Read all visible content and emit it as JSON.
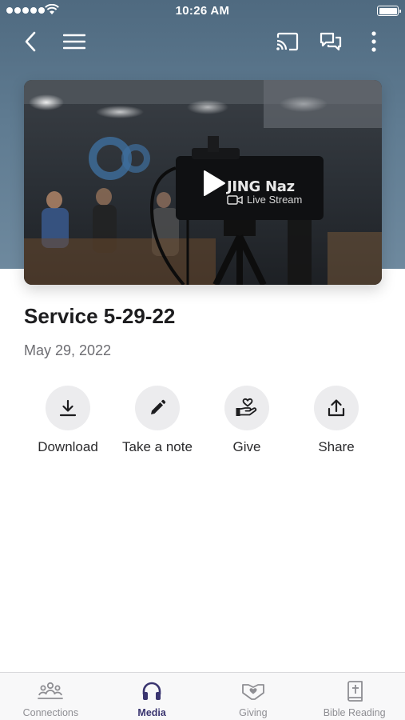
{
  "status_bar": {
    "time": "10:26 AM"
  },
  "video": {
    "overlay_brand": "JING Naz",
    "overlay_subtitle": "Live Stream"
  },
  "sermon": {
    "title": "Service 5-29-22",
    "date": "May 29, 2022"
  },
  "actions": [
    {
      "label": "Download",
      "icon": "download-icon"
    },
    {
      "label": "Take a note",
      "icon": "pencil-icon"
    },
    {
      "label": "Give",
      "icon": "give-icon"
    },
    {
      "label": "Share",
      "icon": "share-icon"
    }
  ],
  "tabs": [
    {
      "label": "Connections",
      "icon": "people-icon",
      "active": false
    },
    {
      "label": "Media",
      "icon": "headphones-icon",
      "active": true
    },
    {
      "label": "Giving",
      "icon": "handshake-heart-icon",
      "active": false
    },
    {
      "label": "Bible Reading",
      "icon": "bible-icon",
      "active": false
    }
  ],
  "colors": {
    "header_bg": "#5f7b91",
    "active_tab": "#3a3570",
    "inactive_tab": "#8e8e93",
    "action_circle": "#ececee"
  }
}
